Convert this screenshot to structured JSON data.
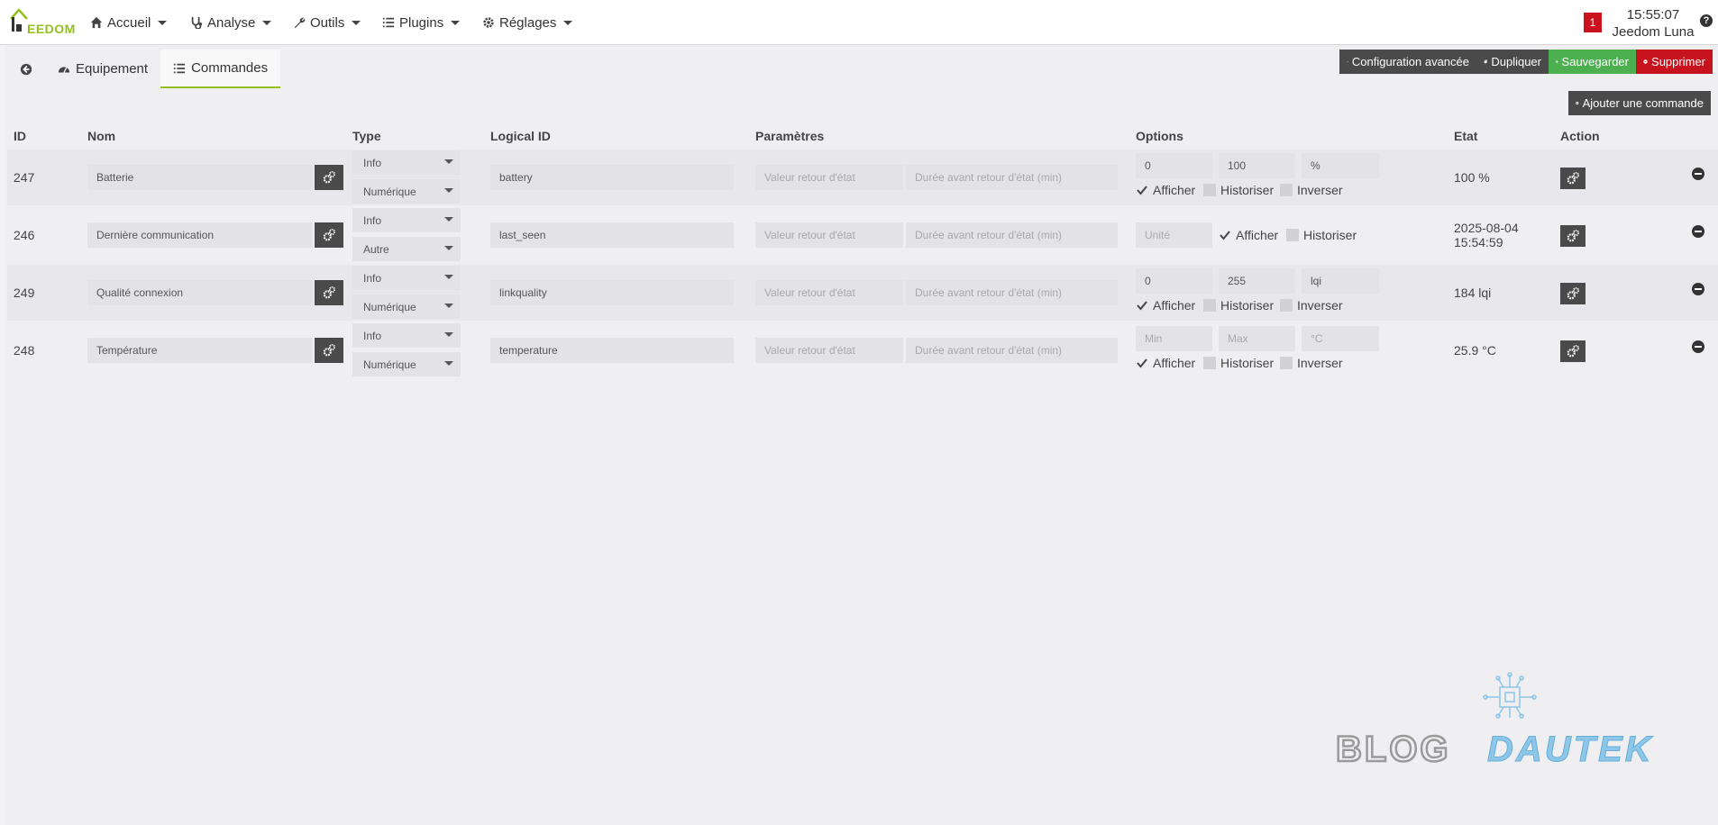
{
  "navbar": {
    "logo_text": "EEDOM",
    "menu": [
      {
        "label": "Accueil",
        "icon": "home-icon"
      },
      {
        "label": "Analyse",
        "icon": "stethoscope-icon"
      },
      {
        "label": "Outils",
        "icon": "wrench-icon"
      },
      {
        "label": "Plugins",
        "icon": "list-icon"
      },
      {
        "label": "Réglages",
        "icon": "gear-icon"
      }
    ],
    "notification_count": "1",
    "time": "15:55:07",
    "box_name": "Jeedom Luna",
    "help": "?"
  },
  "tabs": [
    {
      "label": "",
      "icon": "back-arrow-icon"
    },
    {
      "label": "Equipement",
      "icon": "dashboard-icon"
    },
    {
      "label": "Commandes",
      "icon": "list-icon",
      "active": true
    }
  ],
  "toolbar": {
    "config_label": "Configuration avancée",
    "duplicate_label": "Dupliquer",
    "save_label": "Sauvegarder",
    "delete_label": "Supprimer",
    "add_command_label": "Ajouter une commande"
  },
  "table": {
    "headers": [
      "ID",
      "Nom",
      "Type",
      "Logical ID",
      "Paramètres",
      "Options",
      "Etat",
      "Action"
    ],
    "param_placeholders": {
      "return_value": "Valeur retour d'état",
      "return_delay": "Durée avant retour d'état (min)"
    },
    "option_labels": {
      "show": "Afficher",
      "history": "Historiser",
      "invert": "Inverser"
    },
    "rows": [
      {
        "id": "247",
        "name": "Batterie",
        "type": "Info",
        "subtype": "Numérique",
        "logical_id": "battery",
        "min": "0",
        "max": "100",
        "unit": "%",
        "state": "100 %"
      },
      {
        "id": "246",
        "name": "Dernière communication",
        "type": "Info",
        "subtype": "Autre",
        "logical_id": "last_seen",
        "unit_placeholder": "Unité",
        "state_line1": "2025-08-04",
        "state_line2": "15:54:59"
      },
      {
        "id": "249",
        "name": "Qualité connexion",
        "type": "Info",
        "subtype": "Numérique",
        "logical_id": "linkquality",
        "min": "0",
        "max": "255",
        "unit": "lqi",
        "state": "184 lqi"
      },
      {
        "id": "248",
        "name": "Température",
        "type": "Info",
        "subtype": "Numérique",
        "logical_id": "temperature",
        "min_placeholder": "Min",
        "max_placeholder": "Max",
        "unit_placeholder": "°C",
        "state": "25.9 °C"
      }
    ]
  },
  "watermark": {
    "part1": "BLOG",
    "part2": "DAUTEK"
  },
  "colors": {
    "brand_green": "#93c01f",
    "save_green": "#4caf50",
    "delete_red": "#c7131d",
    "dark_button": "#4a4a4a"
  }
}
